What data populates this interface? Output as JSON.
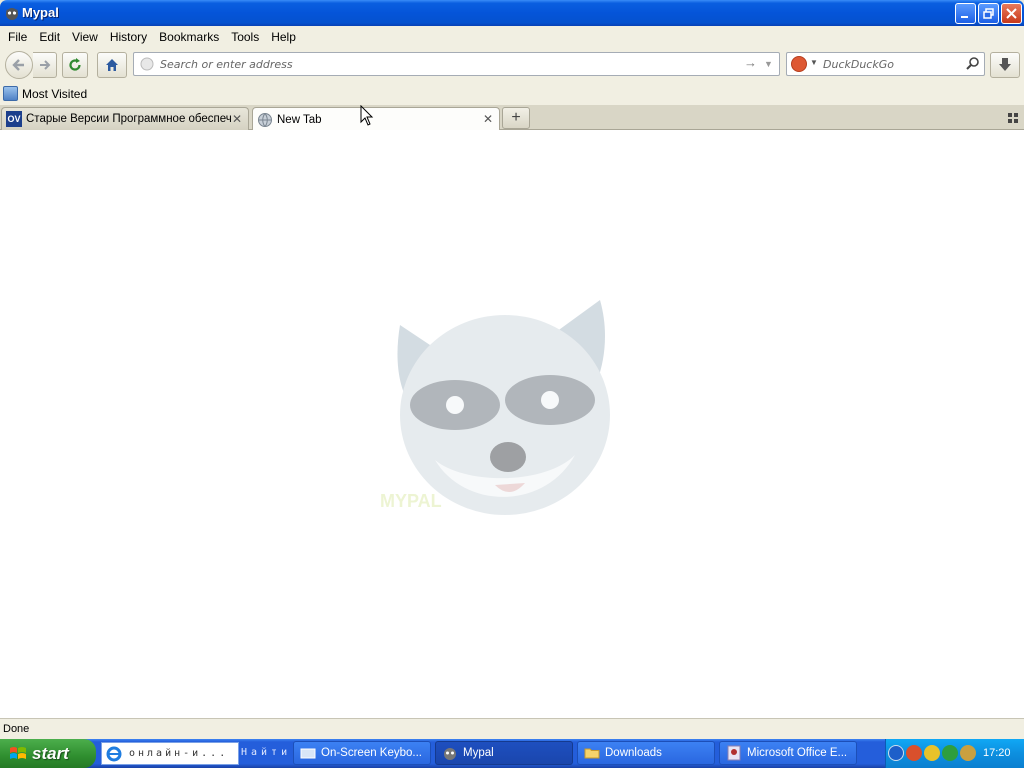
{
  "window": {
    "title": "Mypal"
  },
  "menu": [
    "File",
    "Edit",
    "View",
    "History",
    "Bookmarks",
    "Tools",
    "Help"
  ],
  "nav": {
    "url_placeholder": "Search or enter address",
    "search_placeholder": "DuckDuckGo"
  },
  "bookmarks": [
    {
      "label": "Most Visited"
    }
  ],
  "tabs": [
    {
      "label": "Старые Версии Программное обеспече...",
      "favicon": "OV",
      "active": false
    },
    {
      "label": "New Tab",
      "active": true
    }
  ],
  "content": {
    "mascot_caption": "MYPAL"
  },
  "status": {
    "text": "Done"
  },
  "taskbar": {
    "start_label": "start",
    "quicklaunch_text": "онлайн-и...",
    "find_label": "Найти",
    "tasks": [
      {
        "label": "On-Screen Keybo...",
        "icon": "keyboard-icon"
      },
      {
        "label": "Mypal",
        "icon": "mypal-icon",
        "active": true
      },
      {
        "label": "Downloads",
        "icon": "folder-icon"
      },
      {
        "label": "Microsoft Office E...",
        "icon": "office-icon"
      }
    ],
    "clock": "17:20"
  },
  "colors": {
    "accent": "#245edb",
    "start": "#2f8e2f",
    "tray": "#0d8fdf"
  }
}
